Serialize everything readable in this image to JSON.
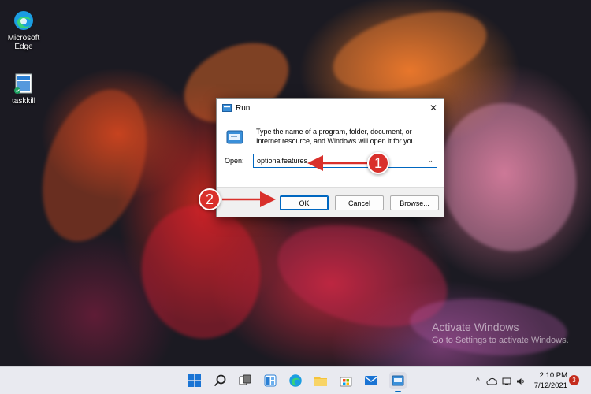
{
  "desktop": {
    "icons": [
      {
        "label_line1": "Microsoft",
        "label_line2": "Edge"
      },
      {
        "label_line1": "taskkill",
        "label_line2": ""
      }
    ]
  },
  "watermark": {
    "title": "Activate Windows",
    "subtitle": "Go to Settings to activate Windows."
  },
  "run_dialog": {
    "title": "Run",
    "description": "Type the name of a program, folder, document, or Internet resource, and Windows will open it for you.",
    "open_label": "Open:",
    "open_value": "optionalfeatures",
    "ok_label": "OK",
    "cancel_label": "Cancel",
    "browse_label": "Browse..."
  },
  "annotations": {
    "step1": "1",
    "step2": "2",
    "color": "#d9302b"
  },
  "taskbar": {
    "icons": [
      "start-icon",
      "search-icon",
      "task-view-icon",
      "widgets-icon",
      "edge-icon",
      "file-explorer-icon",
      "store-icon",
      "mail-icon",
      "run-icon"
    ],
    "clock_time": "2:10 PM",
    "clock_date": "7/12/2021",
    "notification_count": "3"
  },
  "colors": {
    "accent": "#0067c0",
    "taskbar_bg": "#e9eaf0"
  }
}
